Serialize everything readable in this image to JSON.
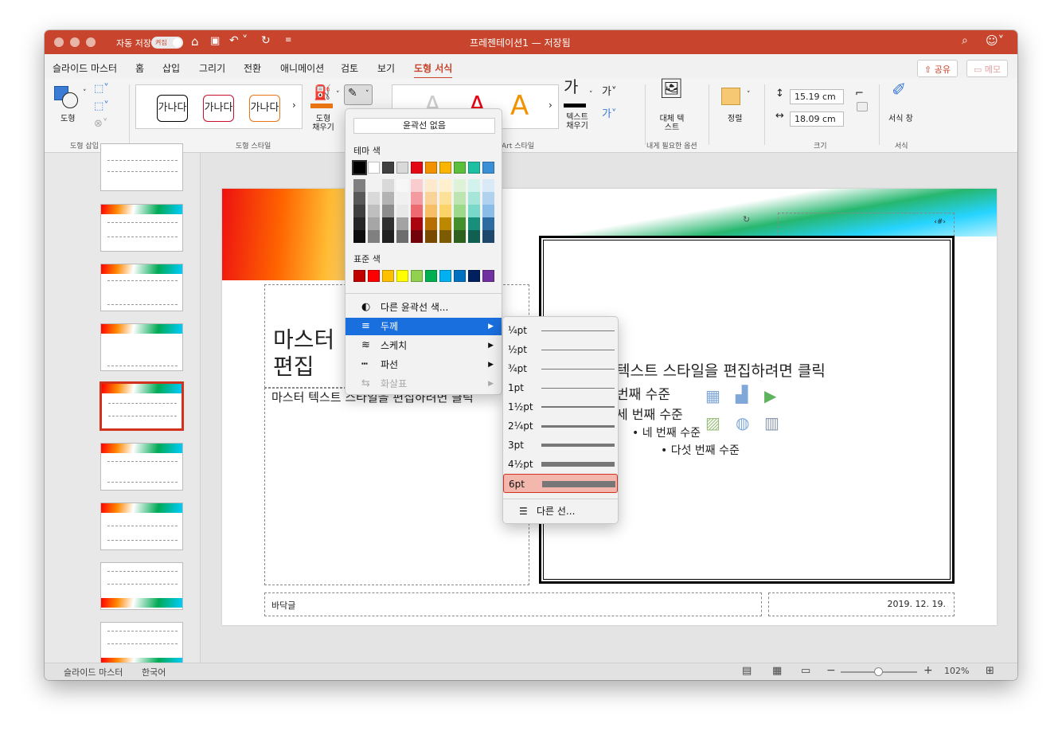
{
  "titlebar": {
    "autosave": "자동 저장",
    "toggle": "켜짐",
    "doc_title": "프레젠테이션1 — 저장됨"
  },
  "tabs": [
    "슬라이드 마스터",
    "홈",
    "삽입",
    "그리기",
    "전환",
    "애니메이션",
    "검토",
    "보기",
    "도형 서식"
  ],
  "share": {
    "share_label": "공유",
    "comment_label": "메모"
  },
  "ribbon": {
    "shape_label": "도형",
    "group_insert": "도형 삽입",
    "style_samples": [
      "가나다",
      "가나다",
      "가나다"
    ],
    "style_colors": [
      "#000000",
      "#c8102e",
      "#e87511"
    ],
    "fill_label": "도형 채우기",
    "group_style": "도형 스타일",
    "art_label": "Art 스타일",
    "text_fill_label": "텍스트 채우기",
    "alt_text_label": "대체 텍스트",
    "group_options": "내게 필요한 옵션",
    "arrange_label": "정렬",
    "height": "15.19 cm",
    "width": "18.09 cm",
    "group_size": "크기",
    "format_pane_label": "서식 창",
    "group_format": "서식"
  },
  "slide": {
    "title_text": "마스터 제목 스타일 편집",
    "title_visible_line1": "마스터",
    "title_visible_line2": "편집",
    "body_left": "마스터 텍스트 스타일을 편집하려면 클릭",
    "page_number": "‹#›",
    "level1": "텍스트 스타일을 편집하려면 클릭",
    "level2": "번째 수준",
    "level3": "세 번째 수준",
    "level4": "네 번째 수준",
    "level5": "다섯 번째 수준",
    "footer": "바닥글",
    "date": "2019. 12. 19."
  },
  "outline_menu": {
    "no_outline": "윤곽선 없음",
    "theme_colors_label": "테마 색",
    "theme_row": [
      "#000000",
      "#ffffff",
      "#404040",
      "#d9d9d9",
      "#e30613",
      "#f39200",
      "#f9b500",
      "#5bbf3c",
      "#1fbfa3",
      "#3a8fd6"
    ],
    "standard_label": "표준 색",
    "standard_row": [
      "#c00000",
      "#ff0000",
      "#ffc000",
      "#ffff00",
      "#92d050",
      "#00b050",
      "#00b0f0",
      "#0070c0",
      "#002060",
      "#7030a0"
    ],
    "more_colors": "다른 윤곽선 색...",
    "weight": "두께",
    "sketch": "스케치",
    "dash": "파선",
    "arrows": "화살표"
  },
  "weight_menu": {
    "items": [
      "¼pt",
      "½pt",
      "¾pt",
      "1pt",
      "1½pt",
      "2¼pt",
      "3pt",
      "4½pt",
      "6pt"
    ],
    "weights_pt": [
      0.25,
      0.5,
      0.75,
      1,
      1.5,
      2.25,
      3,
      4.5,
      6
    ],
    "selected": "6pt",
    "more_lines": "다른 선..."
  },
  "statusbar": {
    "view": "슬라이드 마스터",
    "lang": "한국어",
    "zoom": "102%"
  }
}
